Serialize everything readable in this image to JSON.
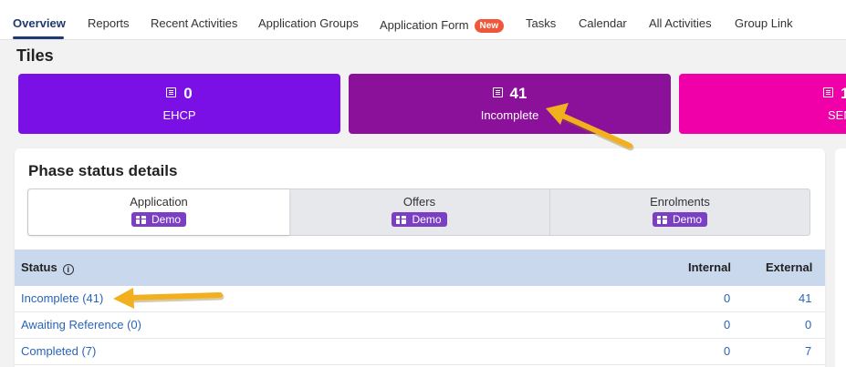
{
  "nav": {
    "tabs": [
      {
        "label": "Overview"
      },
      {
        "label": "Reports"
      },
      {
        "label": "Recent Activities"
      },
      {
        "label": "Application Groups"
      },
      {
        "label": "Application Form",
        "badge": "New"
      },
      {
        "label": "Tasks"
      },
      {
        "label": "Calendar"
      },
      {
        "label": "All Activities"
      },
      {
        "label": "Group Link"
      }
    ],
    "active": "Overview"
  },
  "tiles_section": {
    "title": "Tiles",
    "tiles": [
      {
        "count": "0",
        "label": "EHCP",
        "color": "#7a0fe6",
        "icon": "list-icon"
      },
      {
        "count": "41",
        "label": "Incomplete",
        "color": "#8b119a",
        "icon": "list-icon"
      },
      {
        "count": "1",
        "label": "SEN",
        "color": "#f000a8",
        "icon": "list-icon"
      }
    ]
  },
  "phase": {
    "title": "Phase status details",
    "tabs": [
      {
        "label": "Application",
        "badge": "Demo"
      },
      {
        "label": "Offers",
        "badge": "Demo"
      },
      {
        "label": "Enrolments",
        "badge": "Demo"
      }
    ],
    "badge_color": "#7b3fc4"
  },
  "table": {
    "headers": {
      "status": "Status",
      "internal": "Internal",
      "external": "External"
    },
    "header_bg": "#c9d8ec",
    "rows": [
      {
        "status": "Incomplete (41)",
        "internal": "0",
        "external": "41"
      },
      {
        "status": "Awaiting Reference (0)",
        "internal": "0",
        "external": "0"
      },
      {
        "status": "Completed (7)",
        "internal": "0",
        "external": "7"
      }
    ]
  },
  "annotation_color": "#f2b01e"
}
